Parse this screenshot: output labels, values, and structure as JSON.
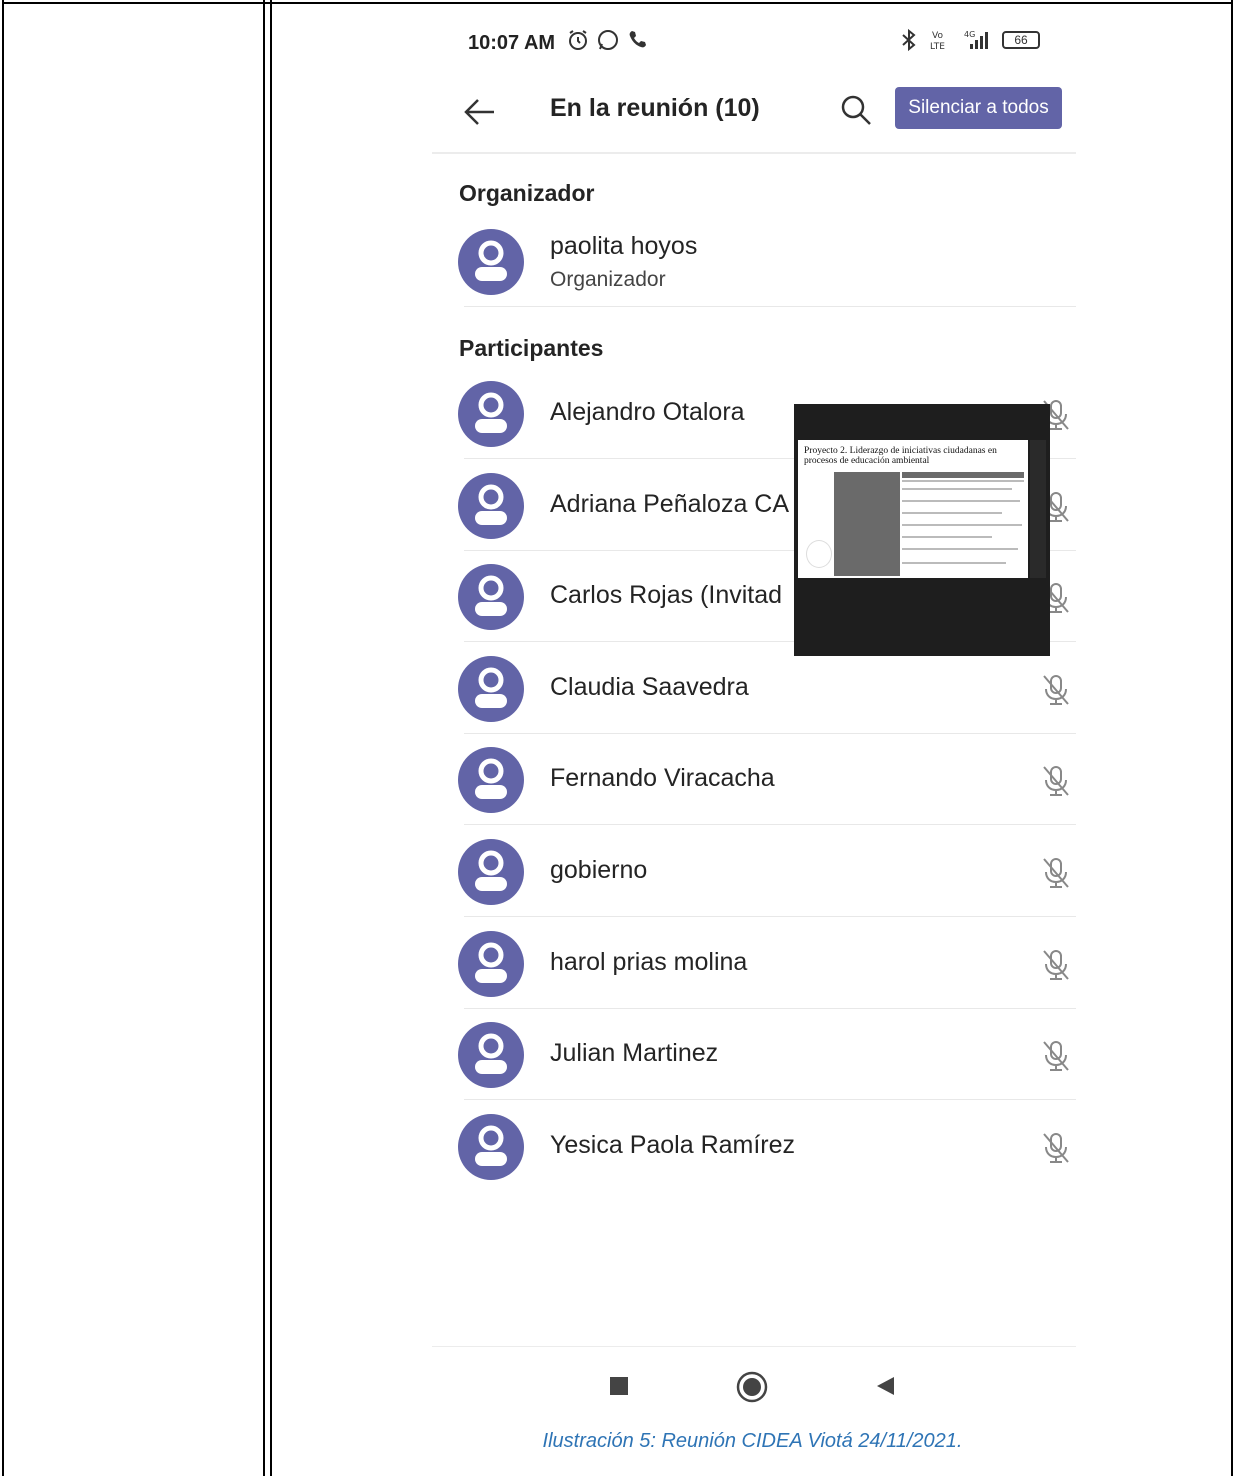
{
  "status_bar": {
    "time": "10:07 AM",
    "battery": "66"
  },
  "header": {
    "title": "En la reunión (10)",
    "mute_all_label": "Silenciar a todos"
  },
  "organizer_section": {
    "heading": "Organizador",
    "name": "paolita hoyos",
    "role": "Organizador"
  },
  "participants_section": {
    "heading": "Participantes",
    "participants": [
      "Alejandro Otalora",
      "Adriana Peñaloza CA",
      "Carlos Rojas (Invitad",
      "Claudia Saavedra",
      "Fernando Viracacha",
      "gobierno",
      "harol prias molina",
      "Julian Martinez",
      "Yesica Paola Ramírez"
    ]
  },
  "pip_slide": {
    "title": "Proyecto 2. Liderazgo de iniciativas ciudadanas en procesos de educación ambiental"
  },
  "caption": "Ilustración 5: Reunión CIDEA Viotá 24/11/2021.",
  "colors": {
    "accent": "#6264a7",
    "caption": "#2e74b5"
  },
  "icons": [
    "back-arrow-icon",
    "search-icon",
    "mic-off-icon",
    "person-icon",
    "stop-icon",
    "home-icon",
    "back-triangle-icon"
  ]
}
